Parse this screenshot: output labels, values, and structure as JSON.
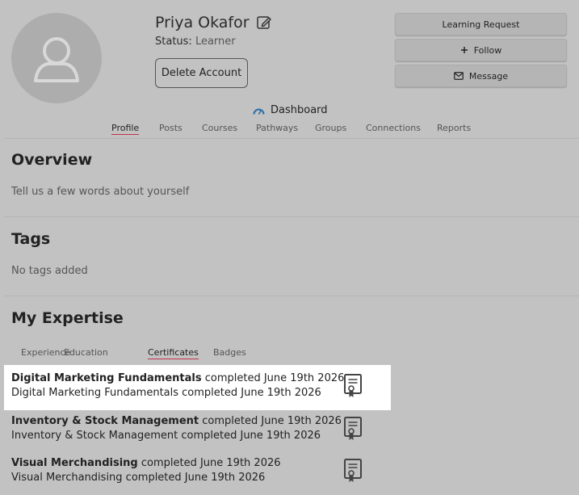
{
  "profile": {
    "name": "Priya Okafor",
    "status_label": "Status:",
    "status_value": "Learner",
    "delete_label": "Delete Account"
  },
  "actions": {
    "learning_request": "Learning Request",
    "follow": "Follow",
    "message": "Message"
  },
  "dashboard_label": "Dashboard",
  "nav_tabs": [
    "Profile",
    "Posts",
    "Courses",
    "Pathways",
    "Groups",
    "Connections",
    "Reports"
  ],
  "overview": {
    "title": "Overview",
    "text": "Tell us a few words about yourself"
  },
  "tags": {
    "title": "Tags",
    "text": "No tags added"
  },
  "expertise": {
    "title": "My Expertise",
    "tabs": [
      "Experience",
      "Education",
      "Certificates",
      "Badges"
    ],
    "certificates": [
      {
        "name": "Digital Marketing Fundamentals",
        "suffix": "completed June 19th 2026",
        "line2": "Digital Marketing Fundamentals completed June 19th 2026"
      },
      {
        "name": "Inventory & Stock Management",
        "suffix": "completed June 19th 2026",
        "line2": "Inventory & Stock Management completed June 19th 2026"
      },
      {
        "name": "Visual Merchandising",
        "suffix": "completed June 19th 2026",
        "line2": "Visual Merchandising completed June 19th 2026"
      }
    ]
  },
  "colors": {
    "overlay_bg": "#c2c2c2",
    "active_tab_underline": "#c0334d",
    "highlight_bg": "#ffffff",
    "dashboard_icon": "#2a6fa8"
  },
  "icons": {
    "avatar": "user-silhouette-icon",
    "edit": "edit-pencil-icon",
    "follow": "plus-icon",
    "message": "envelope-icon",
    "dashboard": "gauge-icon",
    "certificate": "certificate-icon"
  }
}
